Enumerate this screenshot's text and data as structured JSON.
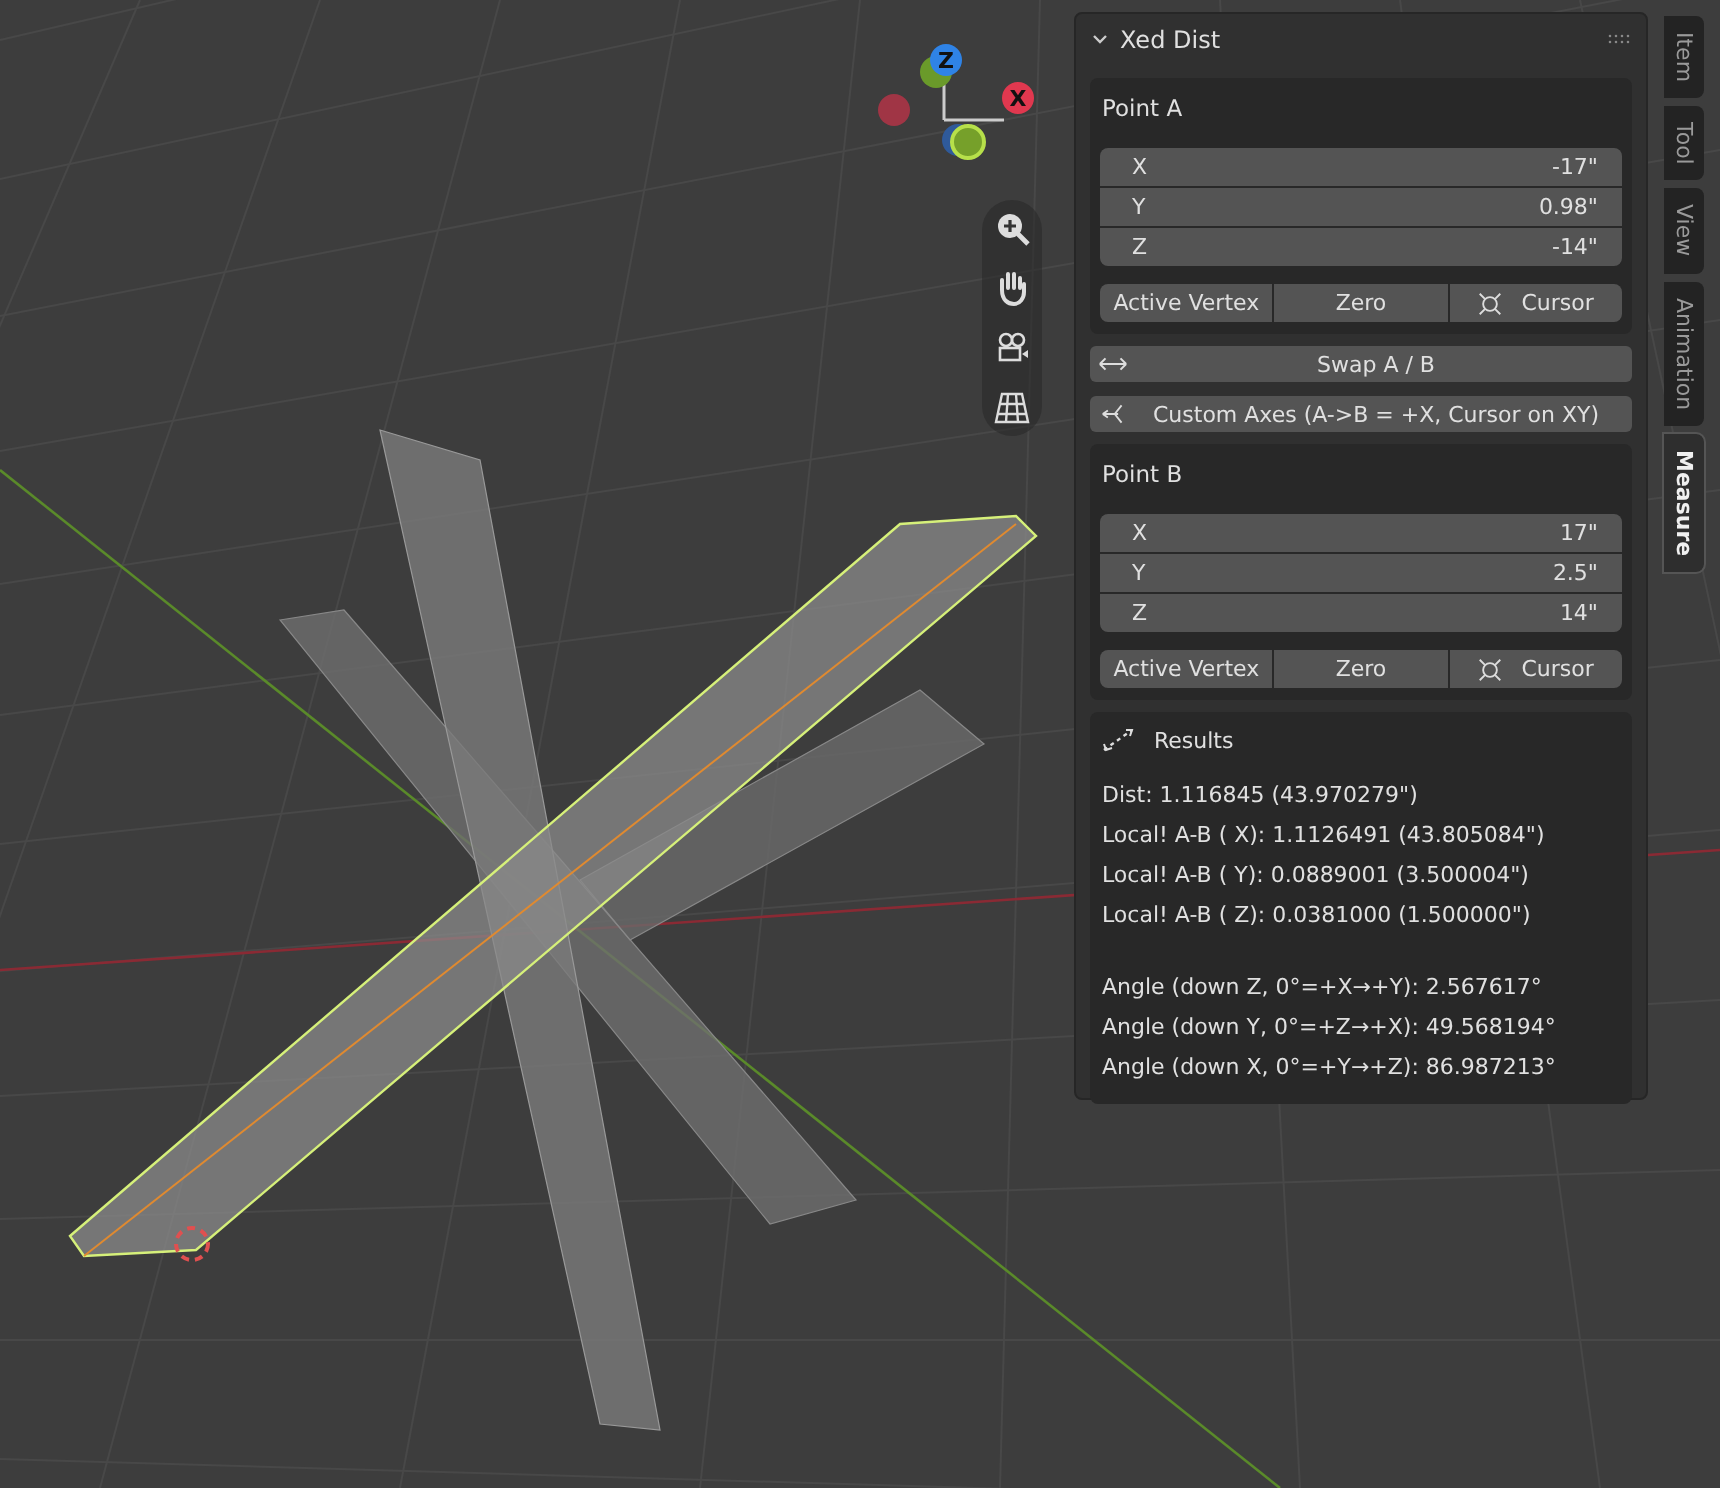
{
  "gizmo": {
    "labels": [
      {
        "axis": "Z",
        "color": "#2f83e6"
      },
      {
        "axis": "X",
        "color": "#e0384f"
      }
    ]
  },
  "panel": {
    "title": "Xed Dist",
    "expanded": true
  },
  "point_a": {
    "label": "Point A",
    "fields": [
      {
        "axis": "X",
        "value": "-17\""
      },
      {
        "axis": "Y",
        "value": "0.98\""
      },
      {
        "axis": "Z",
        "value": "-14\""
      }
    ],
    "buttons": [
      {
        "kind": "plain",
        "label": "Active Vertex"
      },
      {
        "kind": "plain",
        "label": "Zero"
      },
      {
        "kind": "cursor",
        "label": "Cursor"
      }
    ]
  },
  "actions": [
    {
      "kind": "swap",
      "label": "Swap A / B"
    },
    {
      "kind": "axes",
      "label": "Custom Axes (A->B = +X, Cursor on XY)"
    }
  ],
  "point_b": {
    "label": "Point B",
    "fields": [
      {
        "axis": "X",
        "value": "17\""
      },
      {
        "axis": "Y",
        "value": "2.5\""
      },
      {
        "axis": "Z",
        "value": "14\""
      }
    ],
    "buttons": [
      {
        "kind": "plain",
        "label": "Active Vertex"
      },
      {
        "kind": "plain",
        "label": "Zero"
      },
      {
        "kind": "cursor",
        "label": "Cursor"
      }
    ]
  },
  "results": {
    "title": "Results",
    "groups": [
      [
        "Dist: 1.116845 (43.970279\")",
        "Local! A-B ( X): 1.1126491 (43.805084\")",
        "Local! A-B ( Y): 0.0889001 (3.500004\")",
        "Local! A-B ( Z): 0.0381000 (1.500000\")"
      ],
      [
        "Angle (down Z, 0°=+X→+Y): 2.567617°",
        "Angle (down Y, 0°=+Z→+X): 49.568194°",
        "Angle (down X, 0°=+Y→+Z): 86.987213°"
      ]
    ]
  },
  "sidebar_tabs": [
    {
      "label": "Item",
      "selected": false
    },
    {
      "label": "Tool",
      "selected": false
    },
    {
      "label": "View",
      "selected": false
    },
    {
      "label": "Animation",
      "selected": false
    },
    {
      "label": "Measure",
      "selected": true
    }
  ]
}
